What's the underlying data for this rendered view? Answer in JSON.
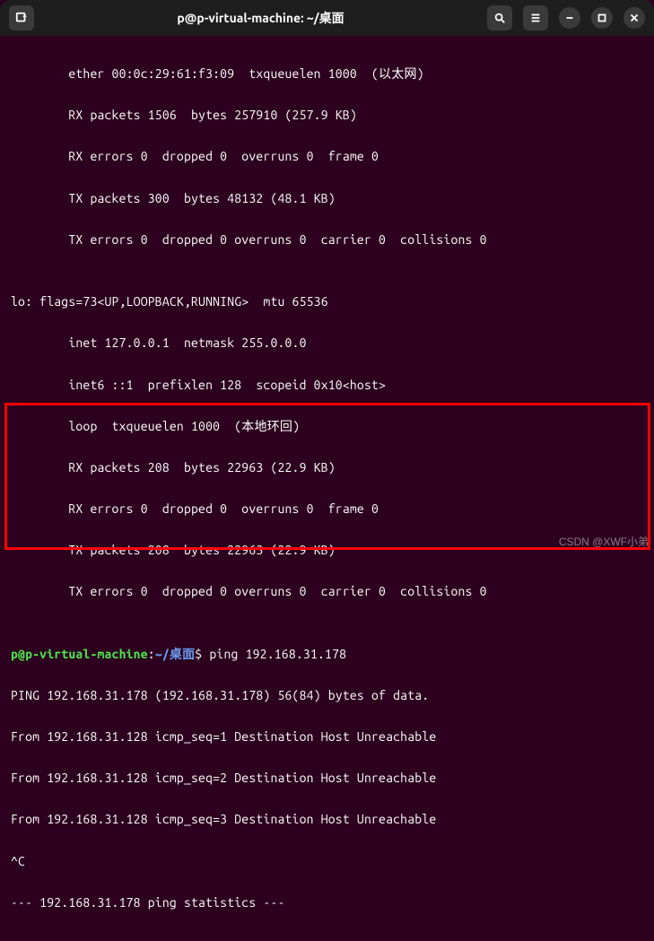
{
  "titlebar": {
    "title": "p@p-virtual-machine: ~/桌面"
  },
  "lines": {
    "l0": "        ether 00:0c:29:61:f3:09  txqueuelen 1000  (以太网)",
    "l1": "        RX packets 1506  bytes 257910 (257.9 KB)",
    "l2": "        RX errors 0  dropped 0  overruns 0  frame 0",
    "l3": "        TX packets 300  bytes 48132 (48.1 KB)",
    "l4": "        TX errors 0  dropped 0 overruns 0  carrier 0  collisions 0",
    "l5": "",
    "l6": "lo: flags=73<UP,LOOPBACK,RUNNING>  mtu 65536",
    "l7": "        inet 127.0.0.1  netmask 255.0.0.0",
    "l8": "        inet6 ::1  prefixlen 128  scopeid 0x10<host>",
    "l9": "        loop  txqueuelen 1000  (本地环回)",
    "l10": "        RX packets 208  bytes 22963 (22.9 KB)",
    "l11": "        RX errors 0  dropped 0  overruns 0  frame 0",
    "l12": "        TX packets 208  bytes 22963 (22.9 KB)",
    "l13": "        TX errors 0  dropped 0 overruns 0  carrier 0  collisions 0",
    "l14": ""
  },
  "prompt": {
    "user_host": "p@p-virtual-machine",
    "colon": ":",
    "path": "~/桌面",
    "dollar": "$ ",
    "command": "ping 192.168.31.178"
  },
  "ping_output": {
    "p0": "PING 192.168.31.178 (192.168.31.178) 56(84) bytes of data.",
    "p1": "From 192.168.31.128 icmp_seq=1 Destination Host Unreachable",
    "p2": "From 192.168.31.128 icmp_seq=2 Destination Host Unreachable",
    "p3": "From 192.168.31.128 icmp_seq=3 Destination Host Unreachable",
    "p4": "^C",
    "p5": "--- 192.168.31.178 ping statistics ---"
  },
  "watermark": "CSDN @XWF小弟"
}
